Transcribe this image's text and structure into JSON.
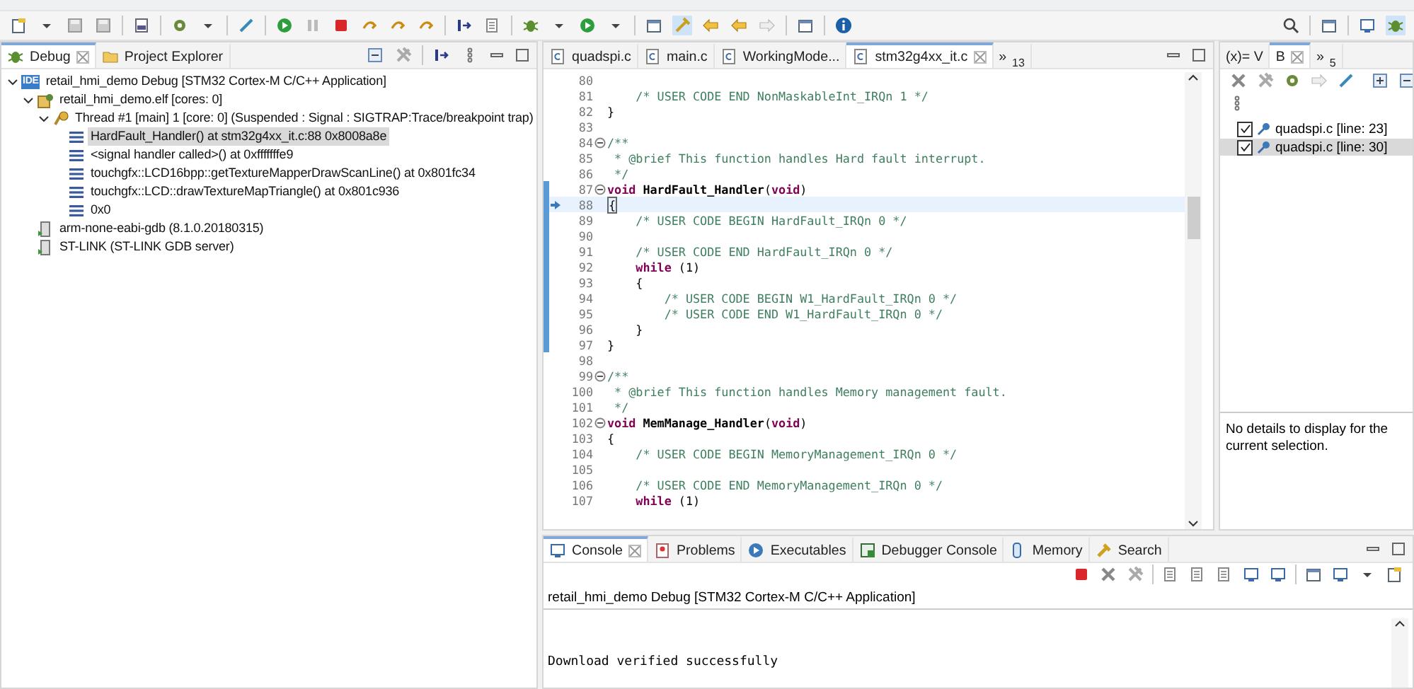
{
  "debug_view": {
    "tabs": [
      {
        "label": "Debug",
        "selected": true
      },
      {
        "label": "Project Explorer",
        "selected": false
      }
    ],
    "tree": [
      {
        "kind": "launch",
        "badge": "IDE",
        "label": "retail_hmi_demo Debug [STM32 Cortex-M C/C++ Application]",
        "expanded": true,
        "selected": false,
        "children": [
          {
            "kind": "program",
            "label": "retail_hmi_demo.elf [cores: 0]",
            "expanded": true,
            "selected": false,
            "children": [
              {
                "kind": "thread",
                "label": "Thread #1 [main] 1 [core: 0] (Suspended : Signal : SIGTRAP:Trace/breakpoint trap)",
                "expanded": true,
                "selected": false,
                "children": [
                  {
                    "kind": "frame",
                    "label": "HardFault_Handler() at stm32g4xx_it.c:88 0x8008a8e",
                    "selected": true
                  },
                  {
                    "kind": "frame",
                    "label": "<signal handler called>() at 0xfffffffe9",
                    "selected": false
                  },
                  {
                    "kind": "frame",
                    "label": "touchgfx::LCD16bpp::getTextureMapperDrawScanLine() at 0x801fc34",
                    "selected": false
                  },
                  {
                    "kind": "frame",
                    "label": "touchgfx::LCD::drawTextureMapTriangle() at 0x801c936",
                    "selected": false
                  },
                  {
                    "kind": "frame",
                    "label": "0x0",
                    "selected": false
                  }
                ]
              }
            ]
          },
          {
            "kind": "process",
            "label": "arm-none-eabi-gdb (8.1.0.20180315)",
            "selected": false
          },
          {
            "kind": "process",
            "label": "ST-LINK (ST-LINK GDB server)",
            "selected": false
          }
        ]
      }
    ]
  },
  "editor": {
    "tabs": [
      {
        "label": "quadspi.c",
        "selected": false
      },
      {
        "label": "main.c",
        "selected": false
      },
      {
        "label": "WorkingMode...",
        "selected": false
      },
      {
        "label": "stm32g4xx_it.c",
        "selected": true
      }
    ],
    "overflow": {
      "symbol": "»",
      "count": "13"
    },
    "lines": [
      {
        "n": "80",
        "fold": false,
        "range": false,
        "current": false
      },
      {
        "n": "81",
        "fold": false,
        "range": false,
        "current": false,
        "parts": [
          {
            "kind": "comment",
            "text": "    /* USER CODE END NonMaskableInt_IRQn 1 */"
          }
        ]
      },
      {
        "n": "82",
        "fold": false,
        "range": false,
        "current": false,
        "parts": [
          {
            "kind": "plain",
            "text": "}"
          }
        ]
      },
      {
        "n": "83",
        "fold": false,
        "range": false,
        "current": false
      },
      {
        "n": "84",
        "fold": true,
        "range": false,
        "current": false,
        "parts": [
          {
            "kind": "comment",
            "text": "/**"
          }
        ]
      },
      {
        "n": "85",
        "fold": false,
        "range": false,
        "current": false,
        "parts": [
          {
            "kind": "comment",
            "text": " * @brief This function handles Hard fault interrupt."
          }
        ]
      },
      {
        "n": "86",
        "fold": false,
        "range": false,
        "current": false,
        "parts": [
          {
            "kind": "comment",
            "text": " */"
          }
        ]
      },
      {
        "n": "87",
        "fold": true,
        "range": true,
        "current": false,
        "parts": [
          {
            "kind": "keyword",
            "text": "void"
          },
          {
            "kind": "function",
            "text": " HardFault_Handler"
          },
          {
            "kind": "plain",
            "text": "("
          },
          {
            "kind": "keyword",
            "text": "void"
          },
          {
            "kind": "plain",
            "text": ")"
          }
        ]
      },
      {
        "n": "88",
        "fold": false,
        "range": true,
        "current": true,
        "parts": [
          {
            "kind": "plain",
            "text": "{"
          }
        ]
      },
      {
        "n": "89",
        "fold": false,
        "range": true,
        "current": false,
        "parts": [
          {
            "kind": "comment",
            "text": "    /* USER CODE BEGIN HardFault_IRQn 0 */"
          }
        ]
      },
      {
        "n": "90",
        "fold": false,
        "range": true,
        "current": false
      },
      {
        "n": "91",
        "fold": false,
        "range": true,
        "current": false,
        "parts": [
          {
            "kind": "comment",
            "text": "    /* USER CODE END HardFault_IRQn 0 */"
          }
        ]
      },
      {
        "n": "92",
        "fold": false,
        "range": true,
        "current": false,
        "parts": [
          {
            "kind": "keyword",
            "text": "    while"
          },
          {
            "kind": "plain",
            "text": " (1)"
          }
        ]
      },
      {
        "n": "93",
        "fold": false,
        "range": true,
        "current": false,
        "parts": [
          {
            "kind": "plain",
            "text": "    {"
          }
        ]
      },
      {
        "n": "94",
        "fold": false,
        "range": true,
        "current": false,
        "parts": [
          {
            "kind": "comment",
            "text": "        /* USER CODE BEGIN W1_HardFault_IRQn 0 */"
          }
        ]
      },
      {
        "n": "95",
        "fold": false,
        "range": true,
        "current": false,
        "parts": [
          {
            "kind": "comment",
            "text": "        /* USER CODE END W1_HardFault_IRQn 0 */"
          }
        ]
      },
      {
        "n": "96",
        "fold": false,
        "range": true,
        "current": false,
        "parts": [
          {
            "kind": "plain",
            "text": "    }"
          }
        ]
      },
      {
        "n": "97",
        "fold": false,
        "range": true,
        "current": false,
        "parts": [
          {
            "kind": "plain",
            "text": "}"
          }
        ]
      },
      {
        "n": "98",
        "fold": false,
        "range": false,
        "current": false
      },
      {
        "n": "99",
        "fold": true,
        "range": false,
        "current": false,
        "parts": [
          {
            "kind": "comment",
            "text": "/**"
          }
        ]
      },
      {
        "n": "100",
        "fold": false,
        "range": false,
        "current": false,
        "parts": [
          {
            "kind": "comment",
            "text": " * @brief This function handles Memory management fault."
          }
        ]
      },
      {
        "n": "101",
        "fold": false,
        "range": false,
        "current": false,
        "parts": [
          {
            "kind": "comment",
            "text": " */"
          }
        ]
      },
      {
        "n": "102",
        "fold": true,
        "range": false,
        "current": false,
        "parts": [
          {
            "kind": "keyword",
            "text": "void"
          },
          {
            "kind": "function",
            "text": " MemManage_Handler"
          },
          {
            "kind": "plain",
            "text": "("
          },
          {
            "kind": "keyword",
            "text": "void"
          },
          {
            "kind": "plain",
            "text": ")"
          }
        ]
      },
      {
        "n": "103",
        "fold": false,
        "range": false,
        "current": false,
        "parts": [
          {
            "kind": "plain",
            "text": "{"
          }
        ]
      },
      {
        "n": "104",
        "fold": false,
        "range": false,
        "current": false,
        "parts": [
          {
            "kind": "comment",
            "text": "    /* USER CODE BEGIN MemoryManagement_IRQn 0 */"
          }
        ]
      },
      {
        "n": "105",
        "fold": false,
        "range": false,
        "current": false
      },
      {
        "n": "106",
        "fold": false,
        "range": false,
        "current": false,
        "parts": [
          {
            "kind": "comment",
            "text": "    /* USER CODE END MemoryManagement_IRQn 0 */"
          }
        ]
      },
      {
        "n": "107",
        "fold": false,
        "range": false,
        "current": false,
        "parts": [
          {
            "kind": "keyword",
            "text": "    while"
          },
          {
            "kind": "plain",
            "text": " (1)"
          }
        ]
      }
    ]
  },
  "breakpoints_view": {
    "tabs": [
      {
        "label": "(x)= V",
        "selected": false
      },
      {
        "label": "B",
        "selected": true
      }
    ],
    "overflow": {
      "symbol": "»",
      "count": "5"
    },
    "items": [
      {
        "label": "quadspi.c [line: 23]",
        "checked": true,
        "selected": false
      },
      {
        "label": "quadspi.c [line: 30]",
        "checked": true,
        "selected": true
      }
    ],
    "details": "No details to display for the current selection."
  },
  "console": {
    "tabs": [
      {
        "label": "Console",
        "selected": true
      },
      {
        "label": "Problems",
        "selected": false
      },
      {
        "label": "Executables",
        "selected": false
      },
      {
        "label": "Debugger Console",
        "selected": false
      },
      {
        "label": "Memory",
        "selected": false
      },
      {
        "label": "Search",
        "selected": false
      }
    ],
    "header": "retail_hmi_demo Debug [STM32 Cortex-M C/C++ Application]",
    "output": [
      "Download verified successfully"
    ]
  }
}
